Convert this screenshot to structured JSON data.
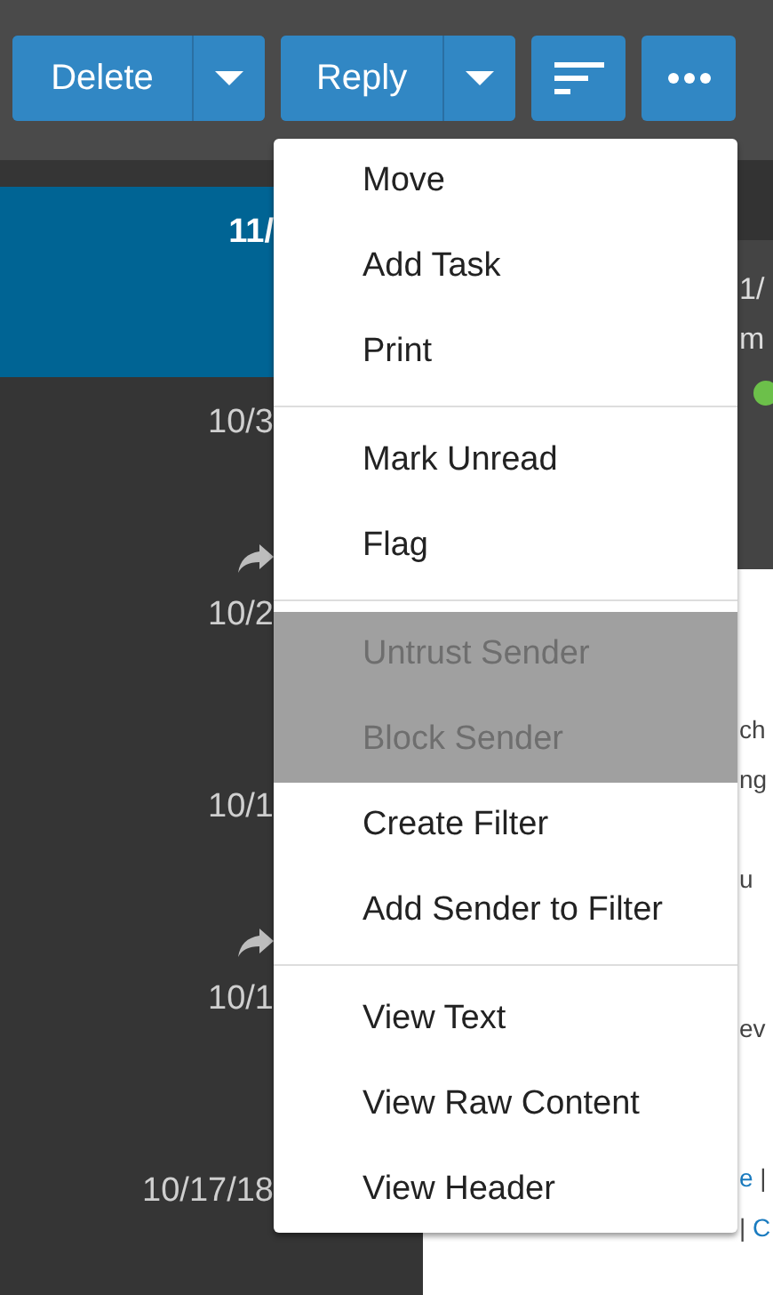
{
  "toolbar": {
    "buttons": [
      {
        "label": "Delete",
        "kind": "split"
      },
      {
        "label": "Reply",
        "kind": "split"
      },
      {
        "kind": "sort"
      },
      {
        "kind": "more"
      }
    ]
  },
  "message_list": {
    "items": [
      {
        "date": "11/",
        "selected": true,
        "replied": false
      },
      {
        "date": "10/3",
        "selected": false,
        "replied": false
      },
      {
        "date": "10/2",
        "selected": false,
        "replied": true
      },
      {
        "date": "10/1",
        "selected": false,
        "replied": false
      },
      {
        "date": "10/1",
        "selected": false,
        "replied": true
      },
      {
        "date": "10/17/18",
        "selected": false,
        "replied": false
      }
    ]
  },
  "reading_pane": {
    "header": {
      "date": "1/",
      "sender": "m",
      "online": true
    },
    "body": [
      {
        "lines": [
          [
            {
              "text": "ch",
              "kind": "text"
            }
          ],
          [
            {
              "text": "ng",
              "kind": "text"
            }
          ]
        ]
      },
      {
        "lines": [
          [
            {
              "text": "u",
              "kind": "text"
            }
          ]
        ]
      },
      {
        "lines": [
          [
            {
              "text": "ev",
              "kind": "text"
            }
          ]
        ]
      },
      {
        "lines": [
          [
            {
              "text": "e",
              "kind": "link"
            },
            {
              "text": " |",
              "kind": "text"
            }
          ],
          [
            {
              "text": "| ",
              "kind": "text"
            },
            {
              "text": "C",
              "kind": "link"
            }
          ]
        ]
      }
    ]
  },
  "context_menu": {
    "items": [
      {
        "kind": "item",
        "label": "Move",
        "disabled": false
      },
      {
        "kind": "item",
        "label": "Add Task",
        "disabled": false
      },
      {
        "kind": "item",
        "label": "Print",
        "disabled": false
      },
      {
        "kind": "divider"
      },
      {
        "kind": "item",
        "label": "Mark Unread",
        "disabled": false
      },
      {
        "kind": "item",
        "label": "Flag",
        "disabled": false
      },
      {
        "kind": "divider"
      },
      {
        "kind": "item",
        "label": "Untrust Sender",
        "disabled": true
      },
      {
        "kind": "item",
        "label": "Block Sender",
        "disabled": true
      },
      {
        "kind": "item",
        "label": "Create Filter",
        "disabled": false
      },
      {
        "kind": "item",
        "label": "Add Sender to Filter",
        "disabled": false
      },
      {
        "kind": "divider"
      },
      {
        "kind": "item",
        "label": "View Text",
        "disabled": false
      },
      {
        "kind": "item",
        "label": "View Raw Content",
        "disabled": false
      },
      {
        "kind": "item",
        "label": "View Header",
        "disabled": false
      }
    ]
  }
}
